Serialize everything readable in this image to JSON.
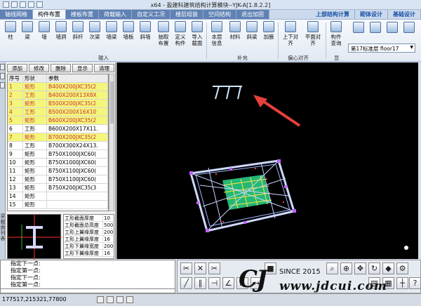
{
  "title": "x64 - 盈建科建筑结构计算模块--YJK-A[1.8.2.2]",
  "menu": {
    "tabs": [
      "轴线网格",
      "构件布置",
      "楼板布置",
      "荷载输入",
      "自定义工况",
      "楼层组装",
      "空间结构",
      "退出加固"
    ],
    "active_index": 1,
    "right_tabs": [
      "上部结构计算",
      "砌体设计",
      "基础设计"
    ]
  },
  "ribbon": {
    "buttons": [
      "柱",
      "梁",
      "墙",
      "墙洞",
      "斜杆",
      "次梁",
      "墙梁",
      "墙板",
      "斜墙",
      "抽取布置",
      "定义构件",
      "导入截面",
      "本层信息",
      "材料",
      "斜梁",
      "加腋",
      "上下对齐",
      "平面对齐",
      "构件查询"
    ],
    "groups": [
      "输入",
      "补充",
      "偏心对齐",
      "显"
    ],
    "floor_select": "第17标准层 floor17"
  },
  "left_panel": {
    "side_label": "梁截面列表",
    "toolbar": [
      "添加",
      "修改",
      "删除",
      "显示",
      "清理"
    ],
    "columns": [
      "序号",
      "形状",
      "参数"
    ],
    "rows": [
      {
        "no": "1",
        "shape": "矩形",
        "param": "B400X200JXC35(2",
        "hl": true
      },
      {
        "no": "2",
        "shape": "工形",
        "param": "B400X200X13X8X",
        "hl": true
      },
      {
        "no": "3",
        "shape": "矩形",
        "param": "B500X200JXC35(2",
        "hl": true
      },
      {
        "no": "4",
        "shape": "工形",
        "param": "B500X200X16X10",
        "hl": true
      },
      {
        "no": "5",
        "shape": "矩形",
        "param": "B600X200JXC35(2",
        "hl": true
      },
      {
        "no": "6",
        "shape": "工形",
        "param": "B600X200X17X11.",
        "hl": false
      },
      {
        "no": "7",
        "shape": "矩形",
        "param": "B700X200JXC35(2",
        "hl": true
      },
      {
        "no": "8",
        "shape": "工形",
        "param": "B700X300X24X13.",
        "hl": false
      },
      {
        "no": "9",
        "shape": "矩形",
        "param": "B750X1000JXC60(",
        "hl": false
      },
      {
        "no": "10",
        "shape": "矩形",
        "param": "B750X1000JXC60(",
        "hl": false
      },
      {
        "no": "11",
        "shape": "矩形",
        "param": "B750X1100JXC60(",
        "hl": false
      },
      {
        "no": "12",
        "shape": "矩形",
        "param": "B750X1100JXC60(",
        "hl": false
      },
      {
        "no": "13",
        "shape": "矩形",
        "param": "B750X200JXC35(3",
        "hl": false
      },
      {
        "no": "14",
        "shape": "矩形",
        "param": "",
        "hl": false
      },
      {
        "no": "15",
        "shape": "矩形",
        "param": "",
        "hl": false
      }
    ],
    "props": [
      {
        "k": "工形截面厚度",
        "v": "10"
      },
      {
        "k": "工形截面总高度",
        "v": "500"
      },
      {
        "k": "工形上翼缘厚度",
        "v": "200"
      },
      {
        "k": "工形上翼缘厚度",
        "v": "16"
      },
      {
        "k": "工形下翼缘宽度",
        "v": "200"
      },
      {
        "k": "工形下翼缘厚度",
        "v": "16"
      }
    ]
  },
  "command": {
    "lines": [
      "指定下一点:",
      "指定第一点:",
      "指定下一点:",
      "指定第一点:"
    ]
  },
  "status": {
    "coords": "177517,215321,77800"
  },
  "watermark": {
    "since": "SINCE 2015",
    "url": "www.jdcui.com"
  },
  "colors": {
    "canvas_bg": "#000000",
    "accent": "#ff3b3b",
    "highlight_row": "#f4f57b"
  }
}
